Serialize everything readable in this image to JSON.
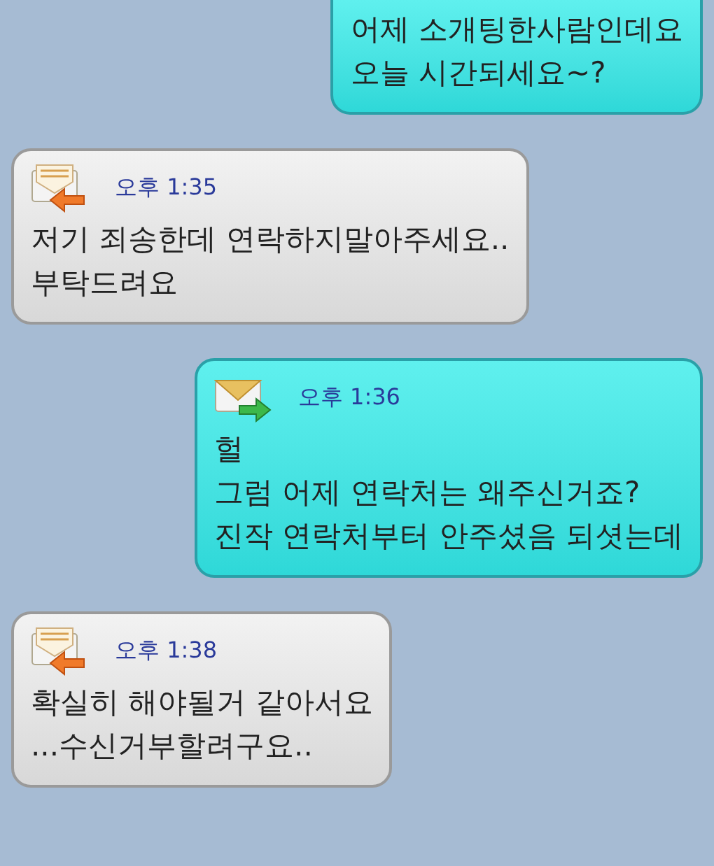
{
  "messages": [
    {
      "kind": "sent",
      "text": "어제 소개팅한사람인데요\n오늘 시간되세요~?"
    },
    {
      "kind": "received",
      "time": "오후 1:35",
      "text": "저기 죄송한데 연락하지말아주세요..\n부탁드려요"
    },
    {
      "kind": "sent",
      "time": "오후 1:36",
      "text": "헐\n그럼 어제 연락처는 왜주신거죠?\n진작 연락처부터 안주셨음 되셧는데"
    },
    {
      "kind": "received",
      "time": "오후 1:38",
      "text": "확실히 해야될거 같아서요\n...수신거부할려구요.."
    }
  ]
}
